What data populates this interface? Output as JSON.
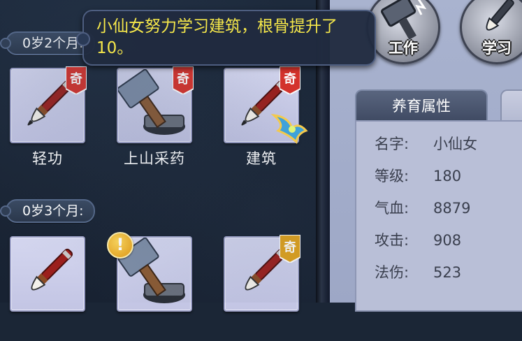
{
  "tooltip": {
    "message": "小仙女努力学习建筑，根骨提升了10。"
  },
  "sections": [
    {
      "label": "0岁2个月:",
      "skills": [
        {
          "name": "轻功",
          "icon": "brush-icon",
          "badge": "奇",
          "badge_color": "#d8322a"
        },
        {
          "name": "上山采药",
          "icon": "hammer-icon",
          "badge": "奇",
          "badge_color": "#d8322a"
        },
        {
          "name": "建筑",
          "icon": "brush-icon",
          "badge": "奇",
          "badge_color": "#d8322a"
        }
      ]
    },
    {
      "label": "0岁3个月:",
      "skills": [
        {
          "name": "",
          "icon": "brush-icon",
          "badge": ""
        },
        {
          "name": "",
          "icon": "hammer-icon",
          "badge": "!",
          "badge_type": "alert"
        },
        {
          "name": "",
          "icon": "brush-icon",
          "badge": "奇",
          "badge_color": "#e0a21c"
        }
      ]
    }
  ],
  "actions": [
    {
      "label": "工作",
      "icon": "hammer-icon"
    },
    {
      "label": "学习",
      "icon": "brush-icon"
    }
  ],
  "panel": {
    "tab_active": "养育属性",
    "attributes": [
      {
        "key": "名字:",
        "value": "小仙女"
      },
      {
        "key": "等级:",
        "value": "180"
      },
      {
        "key": "气血:",
        "value": "8879"
      },
      {
        "key": "攻击:",
        "value": "908"
      },
      {
        "key": "法伤:",
        "value": "523"
      }
    ]
  },
  "colors": {
    "badge_red": "#d8322a",
    "badge_gold": "#e0a21c",
    "tooltip_text": "#f6e84a"
  }
}
